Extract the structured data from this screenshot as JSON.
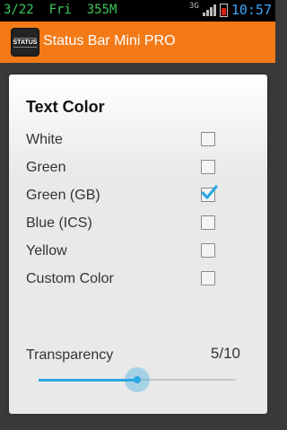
{
  "status_bar": {
    "left_text": "3/22  Fri  355M",
    "network_type": "3G",
    "time": "10:57",
    "colors": {
      "text": "#3fc85a",
      "clock": "#3aa6ff"
    }
  },
  "action_bar": {
    "icon_text": "STATUS",
    "title": "Status Bar Mini PRO",
    "color": "#f47a18"
  },
  "dialog": {
    "title": "Text Color",
    "options": [
      {
        "label": "White",
        "checked": false
      },
      {
        "label": "Green",
        "checked": false
      },
      {
        "label": "Green (GB)",
        "checked": true
      },
      {
        "label": "Blue (ICS)",
        "checked": false
      },
      {
        "label": "Yellow",
        "checked": false
      },
      {
        "label": "Custom Color",
        "checked": false
      }
    ],
    "transparency": {
      "label": "Transparency",
      "value_text": "5/10",
      "value": 5,
      "max": 10
    }
  }
}
